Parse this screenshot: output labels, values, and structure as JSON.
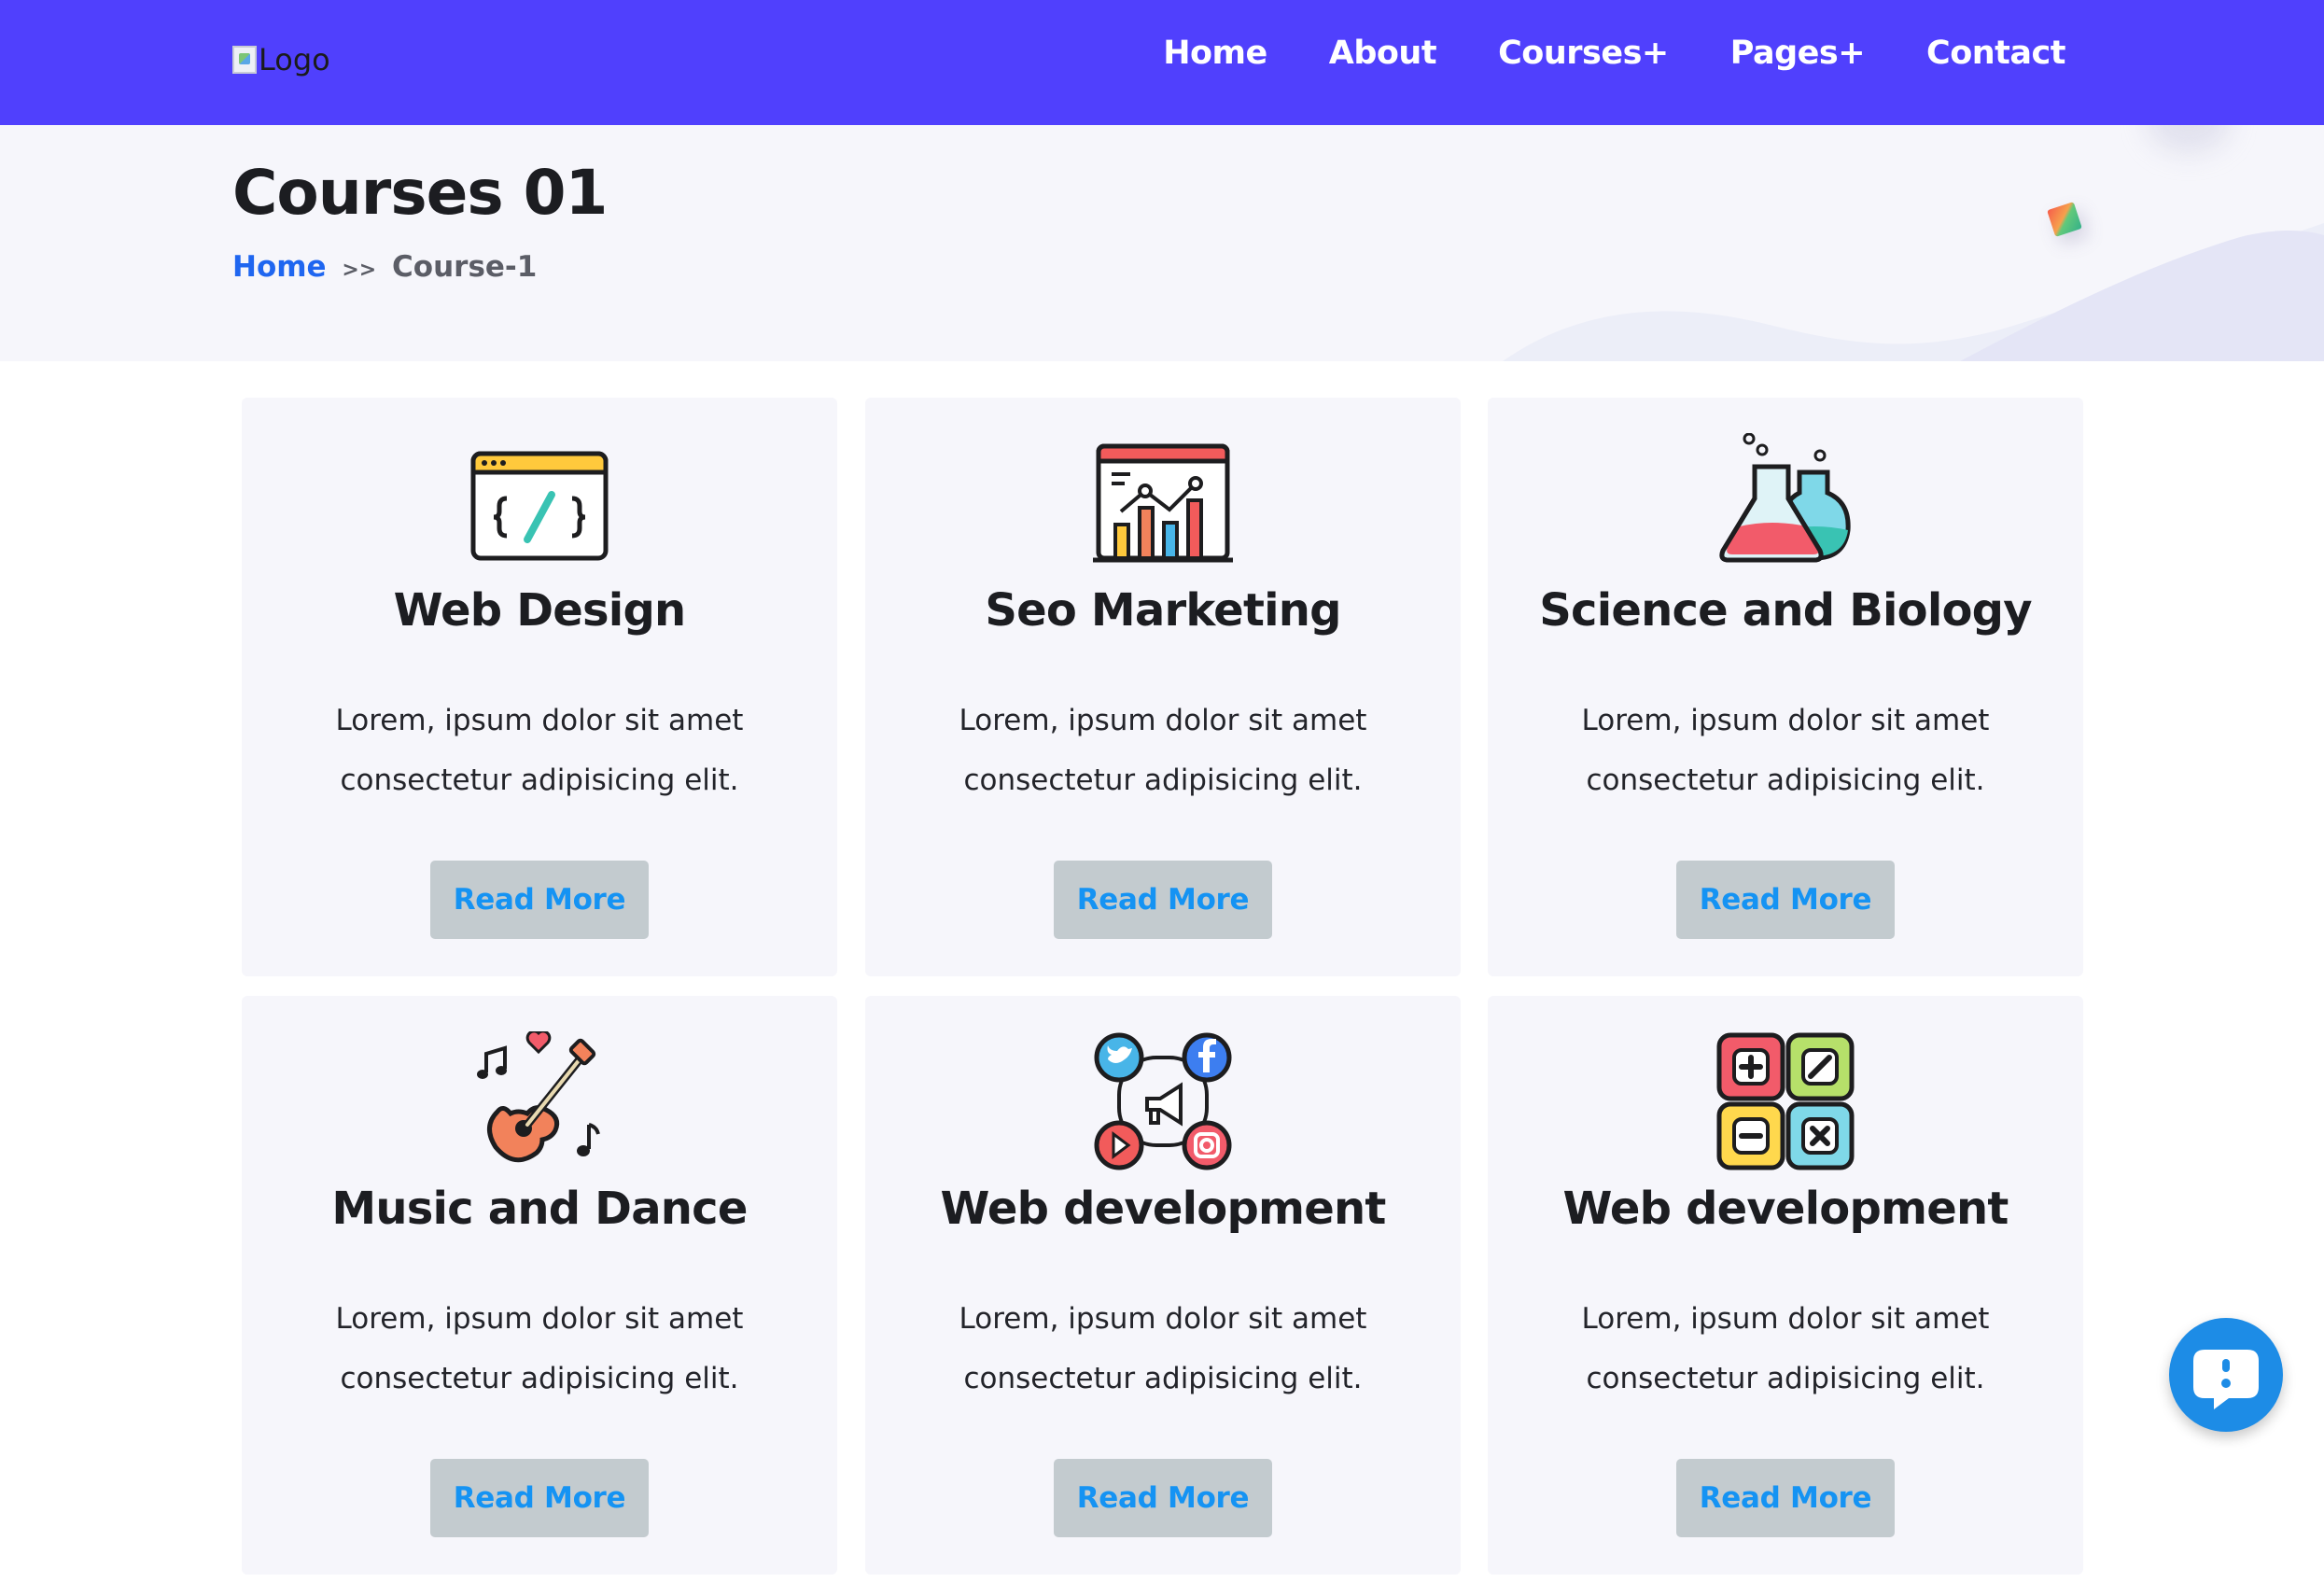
{
  "header": {
    "logo_alt": "Logo",
    "nav": [
      {
        "label": "Home"
      },
      {
        "label": "About"
      },
      {
        "label": "Courses+"
      },
      {
        "label": "Pages+"
      },
      {
        "label": "Contact"
      }
    ]
  },
  "banner": {
    "title": "Courses 01",
    "breadcrumb": {
      "home": "Home",
      "separator": ">>",
      "current": "Course-1"
    }
  },
  "courses": [
    {
      "icon": "code-window-icon",
      "title": "Web Design",
      "description": "Lorem, ipsum dolor sit amet consectetur adipisicing elit.",
      "button": "Read More"
    },
    {
      "icon": "seo-chart-icon",
      "title": "Seo Marketing",
      "description": "Lorem, ipsum dolor sit amet consectetur adipisicing elit.",
      "button": "Read More"
    },
    {
      "icon": "flasks-icon",
      "title": "Science and Biology",
      "description": "Lorem, ipsum dolor sit amet consectetur adipisicing elit.",
      "button": "Read More"
    },
    {
      "icon": "guitar-icon",
      "title": "Music and Dance",
      "description": "Lorem, ipsum dolor sit amet consectetur adipisicing elit.",
      "button": "Read More"
    },
    {
      "icon": "social-media-icon",
      "title": "Web development",
      "description": "Lorem, ipsum dolor sit amet consectetur adipisicing elit.",
      "button": "Read More"
    },
    {
      "icon": "math-operators-icon",
      "title": "Web development",
      "description": "Lorem, ipsum dolor sit amet consectetur adipisicing elit.",
      "button": "Read More"
    }
  ],
  "chat_widget": {
    "icon": "chat-bubble-icon"
  },
  "colors": {
    "navbar": "#5040fd",
    "banner_bg": "#f6f6fb",
    "card_bg": "#f6f6fb",
    "button_bg": "#c3cbcf",
    "button_text": "#1593f3",
    "breadcrumb_link": "#1f66f0",
    "chat_widget": "#1d8ce6"
  }
}
